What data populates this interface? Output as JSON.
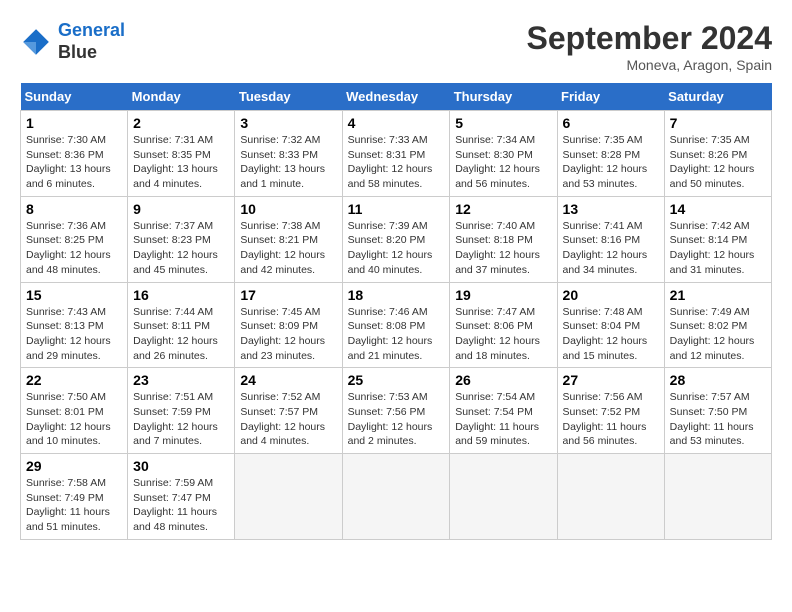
{
  "logo": {
    "line1": "General",
    "line2": "Blue"
  },
  "title": "September 2024",
  "location": "Moneva, Aragon, Spain",
  "weekdays": [
    "Sunday",
    "Monday",
    "Tuesday",
    "Wednesday",
    "Thursday",
    "Friday",
    "Saturday"
  ],
  "weeks": [
    [
      {
        "day": "1",
        "sunrise": "Sunrise: 7:30 AM",
        "sunset": "Sunset: 8:36 PM",
        "daylight": "Daylight: 13 hours and 6 minutes."
      },
      {
        "day": "2",
        "sunrise": "Sunrise: 7:31 AM",
        "sunset": "Sunset: 8:35 PM",
        "daylight": "Daylight: 13 hours and 4 minutes."
      },
      {
        "day": "3",
        "sunrise": "Sunrise: 7:32 AM",
        "sunset": "Sunset: 8:33 PM",
        "daylight": "Daylight: 13 hours and 1 minute."
      },
      {
        "day": "4",
        "sunrise": "Sunrise: 7:33 AM",
        "sunset": "Sunset: 8:31 PM",
        "daylight": "Daylight: 12 hours and 58 minutes."
      },
      {
        "day": "5",
        "sunrise": "Sunrise: 7:34 AM",
        "sunset": "Sunset: 8:30 PM",
        "daylight": "Daylight: 12 hours and 56 minutes."
      },
      {
        "day": "6",
        "sunrise": "Sunrise: 7:35 AM",
        "sunset": "Sunset: 8:28 PM",
        "daylight": "Daylight: 12 hours and 53 minutes."
      },
      {
        "day": "7",
        "sunrise": "Sunrise: 7:35 AM",
        "sunset": "Sunset: 8:26 PM",
        "daylight": "Daylight: 12 hours and 50 minutes."
      }
    ],
    [
      {
        "day": "8",
        "sunrise": "Sunrise: 7:36 AM",
        "sunset": "Sunset: 8:25 PM",
        "daylight": "Daylight: 12 hours and 48 minutes."
      },
      {
        "day": "9",
        "sunrise": "Sunrise: 7:37 AM",
        "sunset": "Sunset: 8:23 PM",
        "daylight": "Daylight: 12 hours and 45 minutes."
      },
      {
        "day": "10",
        "sunrise": "Sunrise: 7:38 AM",
        "sunset": "Sunset: 8:21 PM",
        "daylight": "Daylight: 12 hours and 42 minutes."
      },
      {
        "day": "11",
        "sunrise": "Sunrise: 7:39 AM",
        "sunset": "Sunset: 8:20 PM",
        "daylight": "Daylight: 12 hours and 40 minutes."
      },
      {
        "day": "12",
        "sunrise": "Sunrise: 7:40 AM",
        "sunset": "Sunset: 8:18 PM",
        "daylight": "Daylight: 12 hours and 37 minutes."
      },
      {
        "day": "13",
        "sunrise": "Sunrise: 7:41 AM",
        "sunset": "Sunset: 8:16 PM",
        "daylight": "Daylight: 12 hours and 34 minutes."
      },
      {
        "day": "14",
        "sunrise": "Sunrise: 7:42 AM",
        "sunset": "Sunset: 8:14 PM",
        "daylight": "Daylight: 12 hours and 31 minutes."
      }
    ],
    [
      {
        "day": "15",
        "sunrise": "Sunrise: 7:43 AM",
        "sunset": "Sunset: 8:13 PM",
        "daylight": "Daylight: 12 hours and 29 minutes."
      },
      {
        "day": "16",
        "sunrise": "Sunrise: 7:44 AM",
        "sunset": "Sunset: 8:11 PM",
        "daylight": "Daylight: 12 hours and 26 minutes."
      },
      {
        "day": "17",
        "sunrise": "Sunrise: 7:45 AM",
        "sunset": "Sunset: 8:09 PM",
        "daylight": "Daylight: 12 hours and 23 minutes."
      },
      {
        "day": "18",
        "sunrise": "Sunrise: 7:46 AM",
        "sunset": "Sunset: 8:08 PM",
        "daylight": "Daylight: 12 hours and 21 minutes."
      },
      {
        "day": "19",
        "sunrise": "Sunrise: 7:47 AM",
        "sunset": "Sunset: 8:06 PM",
        "daylight": "Daylight: 12 hours and 18 minutes."
      },
      {
        "day": "20",
        "sunrise": "Sunrise: 7:48 AM",
        "sunset": "Sunset: 8:04 PM",
        "daylight": "Daylight: 12 hours and 15 minutes."
      },
      {
        "day": "21",
        "sunrise": "Sunrise: 7:49 AM",
        "sunset": "Sunset: 8:02 PM",
        "daylight": "Daylight: 12 hours and 12 minutes."
      }
    ],
    [
      {
        "day": "22",
        "sunrise": "Sunrise: 7:50 AM",
        "sunset": "Sunset: 8:01 PM",
        "daylight": "Daylight: 12 hours and 10 minutes."
      },
      {
        "day": "23",
        "sunrise": "Sunrise: 7:51 AM",
        "sunset": "Sunset: 7:59 PM",
        "daylight": "Daylight: 12 hours and 7 minutes."
      },
      {
        "day": "24",
        "sunrise": "Sunrise: 7:52 AM",
        "sunset": "Sunset: 7:57 PM",
        "daylight": "Daylight: 12 hours and 4 minutes."
      },
      {
        "day": "25",
        "sunrise": "Sunrise: 7:53 AM",
        "sunset": "Sunset: 7:56 PM",
        "daylight": "Daylight: 12 hours and 2 minutes."
      },
      {
        "day": "26",
        "sunrise": "Sunrise: 7:54 AM",
        "sunset": "Sunset: 7:54 PM",
        "daylight": "Daylight: 11 hours and 59 minutes."
      },
      {
        "day": "27",
        "sunrise": "Sunrise: 7:56 AM",
        "sunset": "Sunset: 7:52 PM",
        "daylight": "Daylight: 11 hours and 56 minutes."
      },
      {
        "day": "28",
        "sunrise": "Sunrise: 7:57 AM",
        "sunset": "Sunset: 7:50 PM",
        "daylight": "Daylight: 11 hours and 53 minutes."
      }
    ],
    [
      {
        "day": "29",
        "sunrise": "Sunrise: 7:58 AM",
        "sunset": "Sunset: 7:49 PM",
        "daylight": "Daylight: 11 hours and 51 minutes."
      },
      {
        "day": "30",
        "sunrise": "Sunrise: 7:59 AM",
        "sunset": "Sunset: 7:47 PM",
        "daylight": "Daylight: 11 hours and 48 minutes."
      },
      null,
      null,
      null,
      null,
      null
    ]
  ]
}
